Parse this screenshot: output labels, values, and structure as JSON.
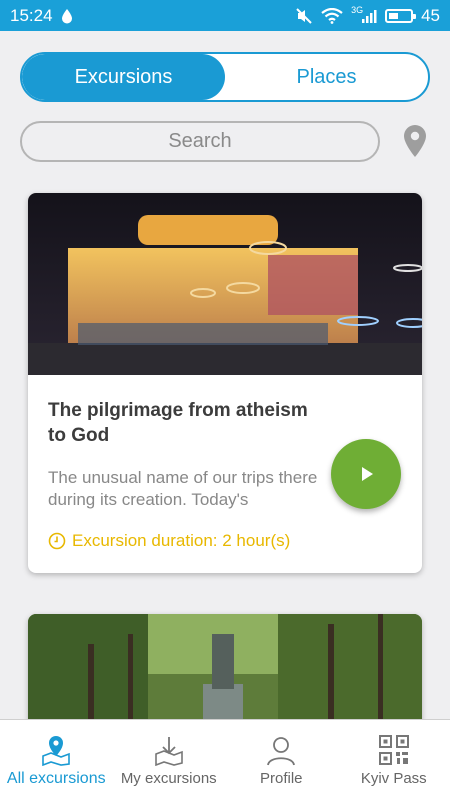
{
  "status_bar": {
    "time": "15:24",
    "network": "3G",
    "battery": "45",
    "battery_level": 0.45
  },
  "tabs": [
    {
      "label": "Excursions",
      "active": true
    },
    {
      "label": "Places",
      "active": false
    }
  ],
  "search": {
    "placeholder": "Search"
  },
  "cards": [
    {
      "title": "The pilgrimage from atheism to God",
      "description": "The unusual name of our trips there during its creation. Today's",
      "duration": "Excursion duration: 2 hour(s)"
    }
  ],
  "bottom_nav": [
    {
      "label": "All excursions",
      "icon": "map-pin-icon",
      "active": true
    },
    {
      "label": "My excursions",
      "icon": "download-map-icon",
      "active": false
    },
    {
      "label": "Profile",
      "icon": "profile-icon",
      "active": false
    },
    {
      "label": "Kyiv Pass",
      "icon": "qr-code-icon",
      "active": false
    }
  ],
  "colors": {
    "accent": "#1a9ad3",
    "status_bar": "#1aa0d8",
    "play_button": "#6fae35",
    "duration": "#e8b800"
  }
}
